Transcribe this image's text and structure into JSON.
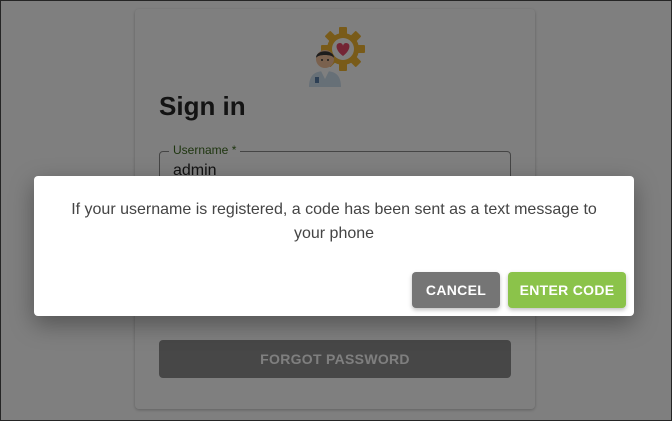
{
  "signin": {
    "logo_icon": "doctor-gear-heart-icon",
    "title": "Sign in",
    "username_label": "Username *",
    "username_value": "admin",
    "forgot_password_label": "FORGOT PASSWORD"
  },
  "dialog": {
    "message": "If your username is registered, a code has been sent as a text message to your phone",
    "cancel_label": "CANCEL",
    "enter_code_label": "ENTER CODE"
  },
  "colors": {
    "accent_green": "#8bc34a",
    "cancel_gray": "#757575",
    "label_green": "#3d6b1f",
    "gear_yellow": "#f2b632",
    "heart_pink": "#e84a6a"
  }
}
